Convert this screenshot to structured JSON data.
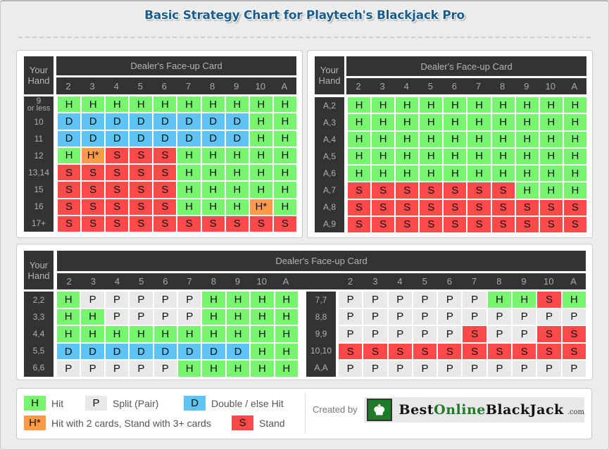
{
  "title": "Basic Strategy Chart for Playtech's Blackjack Pro",
  "headers": {
    "your_hand": [
      "Your",
      "Hand"
    ],
    "dealer_card": "Dealer's Face-up Card",
    "dealer_cards": [
      "2",
      "3",
      "4",
      "5",
      "6",
      "7",
      "8",
      "9",
      "10",
      "A"
    ]
  },
  "hard_totals": {
    "rows": [
      {
        "hand": [
          "9",
          "or less"
        ],
        "actions": [
          "H",
          "H",
          "H",
          "H",
          "H",
          "H",
          "H",
          "H",
          "H",
          "H"
        ]
      },
      {
        "hand": [
          "10"
        ],
        "actions": [
          "D",
          "D",
          "D",
          "D",
          "D",
          "D",
          "D",
          "D",
          "H",
          "H"
        ]
      },
      {
        "hand": [
          "11"
        ],
        "actions": [
          "D",
          "D",
          "D",
          "D",
          "D",
          "D",
          "D",
          "D",
          "H",
          "H"
        ]
      },
      {
        "hand": [
          "12"
        ],
        "actions": [
          "H",
          "H*",
          "S",
          "S",
          "S",
          "H",
          "H",
          "H",
          "H",
          "H"
        ]
      },
      {
        "hand": [
          "13,14"
        ],
        "actions": [
          "S",
          "S",
          "S",
          "S",
          "S",
          "H",
          "H",
          "H",
          "H",
          "H"
        ]
      },
      {
        "hand": [
          "15"
        ],
        "actions": [
          "S",
          "S",
          "S",
          "S",
          "S",
          "H",
          "H",
          "H",
          "H",
          "H"
        ]
      },
      {
        "hand": [
          "16"
        ],
        "actions": [
          "S",
          "S",
          "S",
          "S",
          "S",
          "H",
          "H",
          "H",
          "H*",
          "H"
        ]
      },
      {
        "hand": [
          "17+"
        ],
        "actions": [
          "S",
          "S",
          "S",
          "S",
          "S",
          "S",
          "S",
          "S",
          "S",
          "S"
        ]
      }
    ]
  },
  "soft_totals": {
    "rows": [
      {
        "hand": [
          "A,2"
        ],
        "actions": [
          "H",
          "H",
          "H",
          "H",
          "H",
          "H",
          "H",
          "H",
          "H",
          "H"
        ]
      },
      {
        "hand": [
          "A,3"
        ],
        "actions": [
          "H",
          "H",
          "H",
          "H",
          "H",
          "H",
          "H",
          "H",
          "H",
          "H"
        ]
      },
      {
        "hand": [
          "A,4"
        ],
        "actions": [
          "H",
          "H",
          "H",
          "H",
          "H",
          "H",
          "H",
          "H",
          "H",
          "H"
        ]
      },
      {
        "hand": [
          "A,5"
        ],
        "actions": [
          "H",
          "H",
          "H",
          "H",
          "H",
          "H",
          "H",
          "H",
          "H",
          "H"
        ]
      },
      {
        "hand": [
          "A,6"
        ],
        "actions": [
          "H",
          "H",
          "H",
          "H",
          "H",
          "H",
          "H",
          "H",
          "H",
          "H"
        ]
      },
      {
        "hand": [
          "A,7"
        ],
        "actions": [
          "S",
          "S",
          "S",
          "S",
          "S",
          "S",
          "S",
          "H",
          "H",
          "H"
        ]
      },
      {
        "hand": [
          "A,8"
        ],
        "actions": [
          "S",
          "S",
          "S",
          "S",
          "S",
          "S",
          "S",
          "S",
          "S",
          "S"
        ]
      },
      {
        "hand": [
          "A,9"
        ],
        "actions": [
          "S",
          "S",
          "S",
          "S",
          "S",
          "S",
          "S",
          "S",
          "S",
          "S"
        ]
      }
    ]
  },
  "pairs_left": {
    "rows": [
      {
        "hand": [
          "2,2"
        ],
        "actions": [
          "H",
          "P",
          "P",
          "P",
          "P",
          "P",
          "H",
          "H",
          "H",
          "H"
        ]
      },
      {
        "hand": [
          "3,3"
        ],
        "actions": [
          "H",
          "H",
          "P",
          "P",
          "P",
          "P",
          "H",
          "H",
          "H",
          "H"
        ]
      },
      {
        "hand": [
          "4,4"
        ],
        "actions": [
          "H",
          "H",
          "H",
          "H",
          "H",
          "H",
          "H",
          "H",
          "H",
          "H"
        ]
      },
      {
        "hand": [
          "5,5"
        ],
        "actions": [
          "D",
          "D",
          "D",
          "D",
          "D",
          "D",
          "D",
          "D",
          "H",
          "H"
        ]
      },
      {
        "hand": [
          "6,6"
        ],
        "actions": [
          "P",
          "P",
          "P",
          "P",
          "P",
          "H",
          "H",
          "H",
          "H",
          "H"
        ]
      }
    ]
  },
  "pairs_right": {
    "rows": [
      {
        "hand": [
          "7,7"
        ],
        "actions": [
          "P",
          "P",
          "P",
          "P",
          "P",
          "P",
          "H",
          "H",
          "S",
          "H"
        ]
      },
      {
        "hand": [
          "8,8"
        ],
        "actions": [
          "P",
          "P",
          "P",
          "P",
          "P",
          "P",
          "P",
          "P",
          "P",
          "P"
        ]
      },
      {
        "hand": [
          "9,9"
        ],
        "actions": [
          "P",
          "P",
          "P",
          "P",
          "P",
          "S",
          "P",
          "P",
          "S",
          "S"
        ]
      },
      {
        "hand": [
          "10,10"
        ],
        "actions": [
          "S",
          "S",
          "S",
          "S",
          "S",
          "S",
          "S",
          "S",
          "S",
          "S"
        ]
      },
      {
        "hand": [
          "A,A"
        ],
        "actions": [
          "P",
          "P",
          "P",
          "P",
          "P",
          "P",
          "P",
          "P",
          "P",
          "P"
        ]
      }
    ]
  },
  "colors": {
    "H": "#77f56f",
    "D": "#5dc4f4",
    "S": "#fc4a4a",
    "P": "#e9e9e9",
    "H*": "#fb9a48",
    "title": "#1a5c8c",
    "header_bg": "#333333"
  },
  "legend": {
    "hit": {
      "code": "H",
      "label": "Hit"
    },
    "split": {
      "code": "P",
      "label": "Split (Pair)"
    },
    "double": {
      "code": "D",
      "label": "Double / else Hit"
    },
    "hit_star": {
      "code": "H*",
      "label": "Hit with 2 cards, Stand with 3+ cards"
    },
    "stand": {
      "code": "S",
      "label": "Stand"
    }
  },
  "footer": {
    "created_by": "Created by",
    "logo": {
      "part1": "Best",
      "part2": "Online",
      "part3": "BlackJack",
      "tld": ".com"
    }
  }
}
